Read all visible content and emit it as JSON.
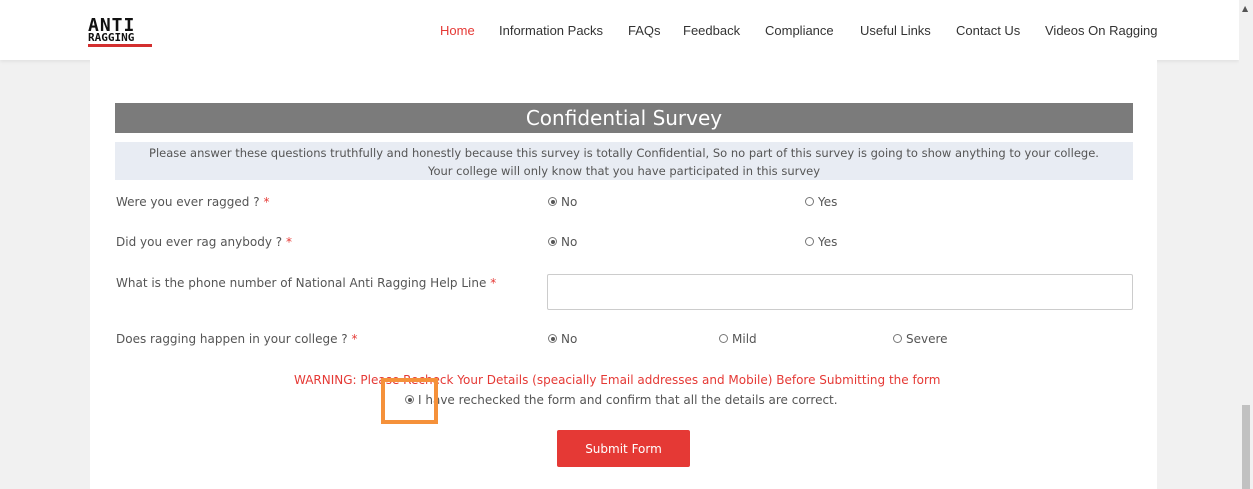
{
  "header": {
    "logo_line1": "ANTI",
    "logo_line2": "RAGGING",
    "nav": [
      "Home",
      "Information Packs",
      "FAQs",
      "Feedback",
      "Compliance",
      "Useful Links",
      "Contact Us",
      "Videos On Ragging"
    ],
    "active_nav": "Home",
    "accent_color": "#e53935"
  },
  "survey": {
    "title": "Confidential Survey",
    "intro_line1": "Please answer these questions truthfully and honestly because this survey is totally Confidential, So no part of this survey is going to show anything to your college.",
    "intro_line2": "Your college will only know that you have participated in this survey",
    "questions": [
      {
        "label": "Were you ever ragged ?",
        "options": [
          "No",
          "Yes"
        ],
        "selected": "No"
      },
      {
        "label": "Did you ever rag anybody ?",
        "options": [
          "No",
          "Yes"
        ],
        "selected": "No"
      },
      {
        "label": "What is the phone number of National Anti Ragging Help Line",
        "value": "",
        "placeholder": ""
      },
      {
        "label": "Does ragging happen in your college ?",
        "options": [
          "No",
          "Mild",
          "Severe"
        ],
        "selected": "No"
      }
    ],
    "required_marker": "*",
    "warning": "WARNING: Please Recheck Your Details (speacially Email addresses and Mobile) Before Submitting the form",
    "confirm_label": "I have rechecked the form and confirm that all the details are correct.",
    "confirm_checked": true,
    "submit_label": "Submit Form"
  }
}
